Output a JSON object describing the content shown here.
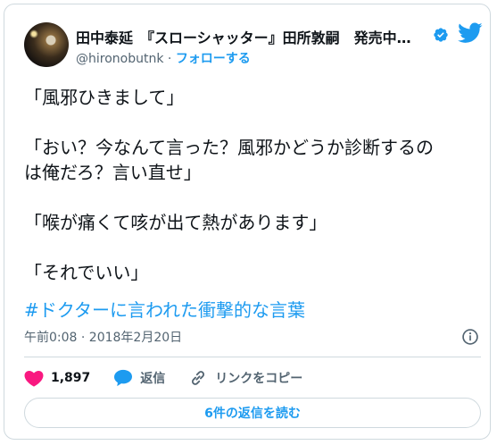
{
  "header": {
    "display_name": "田中泰延　『スローシャッター』田所敦嗣　発売中…",
    "handle": "@hironobutnk",
    "separator": "·",
    "follow_label": "フォローする"
  },
  "tweet": {
    "lines": [
      "「風邪ひきまして」",
      "「おい？今なんて言った？風邪かどうか診断するの",
      "は俺だろ？言い直せ」",
      "「喉が痛くて咳が出て熱があります」",
      "「それでいい」"
    ],
    "hashtag": "#ドクターに言われた衝撃的な言葉",
    "timestamp": "午前0:08 · 2018年2月20日"
  },
  "actions": {
    "like_count": "1,897",
    "reply_label": "返信",
    "copy_link_label": "リンクをコピー"
  },
  "read_replies_label": "6件の返信を読む",
  "colors": {
    "accent": "#1d9bf0",
    "like": "#f91880",
    "text": "#0f1419",
    "muted": "#536471",
    "border": "#cfd9de"
  },
  "icons": [
    "verified-badge-icon",
    "twitter-bird-icon",
    "info-icon",
    "heart-icon",
    "reply-bubble-icon",
    "link-icon"
  ]
}
